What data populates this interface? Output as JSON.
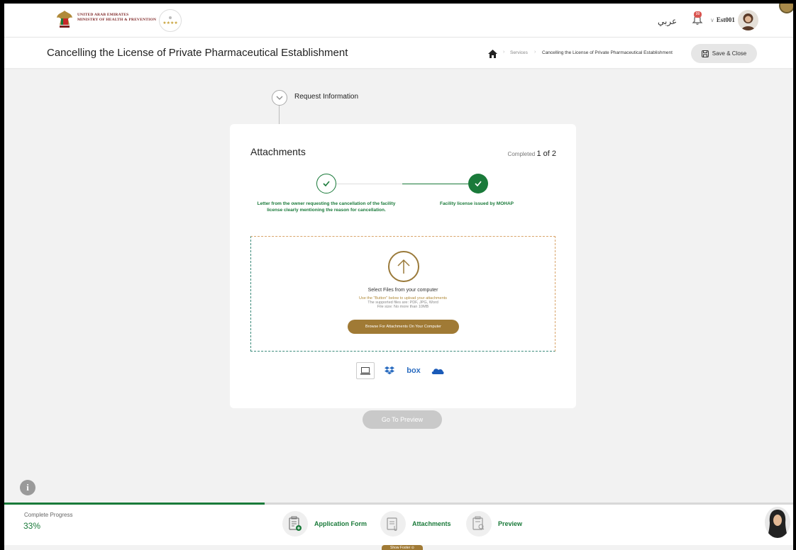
{
  "header": {
    "logo_line1": "UNITED ARAB EMIRATES",
    "logo_line2": "MINISTRY OF HEALTH & PREVENTION",
    "language": "عربي",
    "notification_count": "99",
    "username": "Est001",
    "icon_bell": "bell-icon",
    "icon_avatar": "user-avatar"
  },
  "titlebar": {
    "title": "Cancelling the License of Private Pharmaceutical Establishment",
    "breadcrumb": [
      "Services",
      "Cancelling the License of Private Pharmaceutical Establishment"
    ],
    "save_label": "Save & Close"
  },
  "stepper": {
    "current_step_label": "Request Information"
  },
  "attachments": {
    "title": "Attachments",
    "completed_prefix": "Completed",
    "completed_value": "1 of 2",
    "documents": [
      {
        "label": "Letter from the owner requesting the cancellation of the facility license clearly mentioning the reason for cancellation.",
        "done": true
      },
      {
        "label": "Facility license issued by MOHAP",
        "done": true
      }
    ],
    "dropzone": {
      "heading": "Select Files from your computer",
      "hint1": "Use the \"Button\" below to upload your attachments",
      "hint2": "The supported files are: PDF, JPG, Word",
      "hint3": "File size: No more than 10MB",
      "browse_label": "Browse For Attachments On Your Computer"
    },
    "sources": [
      "computer-icon",
      "dropbox-icon",
      "box",
      "onedrive-icon"
    ],
    "source_box_label": "box"
  },
  "preview_button": "Go To Preview",
  "footer": {
    "progress_label": "Complete Progress",
    "progress_value": "33%",
    "progress_fraction": 0.33,
    "steps": [
      {
        "label": "Application Form",
        "icon": "form-icon"
      },
      {
        "label": "Attachments",
        "icon": "attachment-icon"
      },
      {
        "label": "Preview",
        "icon": "preview-icon"
      }
    ],
    "show_footer": "Show Footer"
  },
  "colors": {
    "accent_green": "#1a7a3a",
    "gold": "#a07a35"
  }
}
